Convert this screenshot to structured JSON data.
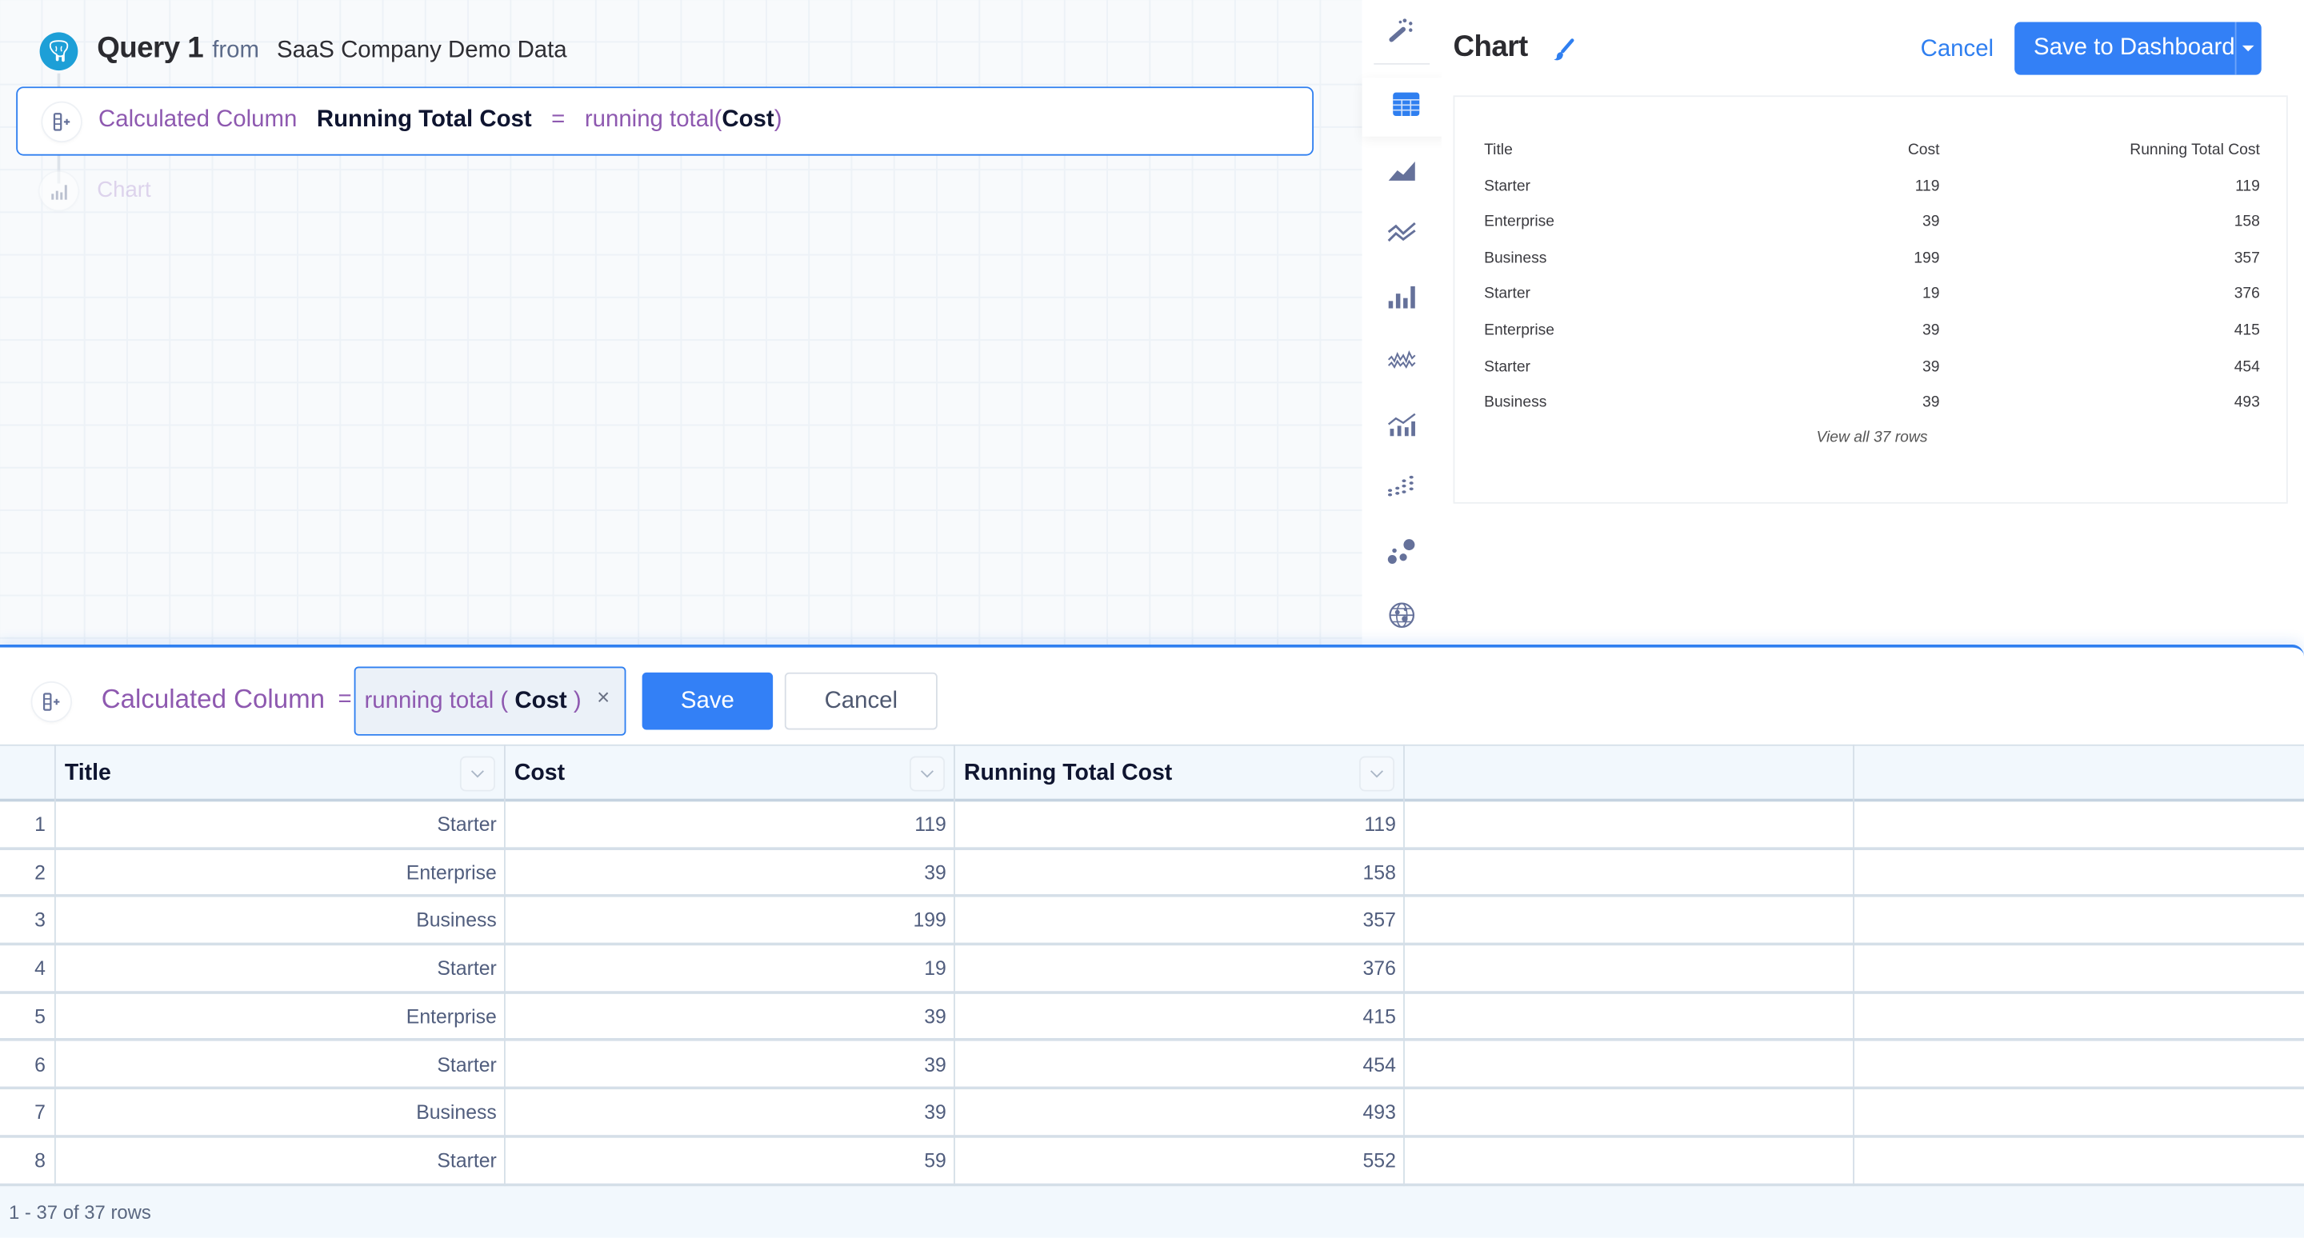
{
  "query": {
    "title": "Query 1",
    "from_label": "from",
    "source": "SaaS Company Demo Data",
    "source_icon": "postgres-elephant-icon"
  },
  "steps": {
    "calc_column": {
      "type_label": "Calculated Column",
      "name": "Running Total Cost",
      "equals": "=",
      "func": "running total",
      "open_paren": "(",
      "arg": "Cost",
      "close_paren": ")",
      "icon": "add-column-icon"
    },
    "chart": {
      "label": "Chart",
      "icon": "bar-chart-icon"
    }
  },
  "chart_types": [
    {
      "name": "auto-suggest",
      "icon": "magic-wand-icon",
      "active": false
    },
    {
      "name": "table",
      "icon": "table-icon",
      "active": true
    },
    {
      "name": "area",
      "icon": "area-chart-icon",
      "active": false
    },
    {
      "name": "line",
      "icon": "line-chart-icon",
      "active": false
    },
    {
      "name": "bar",
      "icon": "bar-chart-icon",
      "active": false
    },
    {
      "name": "sparkline",
      "icon": "sparkline-icon",
      "active": false
    },
    {
      "name": "combo",
      "icon": "combo-chart-icon",
      "active": false
    },
    {
      "name": "scatter",
      "icon": "scatter-icon",
      "active": false
    },
    {
      "name": "bubble",
      "icon": "bubble-icon",
      "active": false
    },
    {
      "name": "map",
      "icon": "globe-icon",
      "active": false
    }
  ],
  "chart_panel": {
    "title": "Chart",
    "style_icon": "paintbrush-icon",
    "cancel_label": "Cancel",
    "save_label": "Save to Dashboard",
    "save_dropdown_icon": "caret-down-icon",
    "preview": {
      "columns": [
        "Title",
        "Cost",
        "Running Total Cost"
      ],
      "rows": [
        [
          "Starter",
          "119",
          "119"
        ],
        [
          "Enterprise",
          "39",
          "158"
        ],
        [
          "Business",
          "199",
          "357"
        ],
        [
          "Starter",
          "19",
          "376"
        ],
        [
          "Enterprise",
          "39",
          "415"
        ],
        [
          "Starter",
          "39",
          "454"
        ],
        [
          "Business",
          "39",
          "493"
        ]
      ],
      "view_all_label": "View all 37 rows"
    }
  },
  "editor": {
    "label": "Calculated Column",
    "equals": "=",
    "formula": {
      "func": "running total",
      "open": "(",
      "arg": "Cost",
      "close": ")",
      "clear_icon": "×"
    },
    "save_label": "Save",
    "cancel_label": "Cancel"
  },
  "grid": {
    "columns": [
      "Title",
      "Cost",
      "Running Total Cost",
      "",
      ""
    ],
    "rows": [
      {
        "n": "1",
        "title": "Starter",
        "cost": "119",
        "running": "119"
      },
      {
        "n": "2",
        "title": "Enterprise",
        "cost": "39",
        "running": "158"
      },
      {
        "n": "3",
        "title": "Business",
        "cost": "199",
        "running": "357"
      },
      {
        "n": "4",
        "title": "Starter",
        "cost": "19",
        "running": "376"
      },
      {
        "n": "5",
        "title": "Enterprise",
        "cost": "39",
        "running": "415"
      },
      {
        "n": "6",
        "title": "Starter",
        "cost": "39",
        "running": "454"
      },
      {
        "n": "7",
        "title": "Business",
        "cost": "39",
        "running": "493"
      },
      {
        "n": "8",
        "title": "Starter",
        "cost": "59",
        "running": "552"
      }
    ],
    "footer": "1 - 37 of 37 rows"
  },
  "colors": {
    "accent": "#3380f6",
    "purple": "#8e59b0",
    "icon_gray": "#65719a",
    "postgres_blue": "#1d9fd7"
  }
}
